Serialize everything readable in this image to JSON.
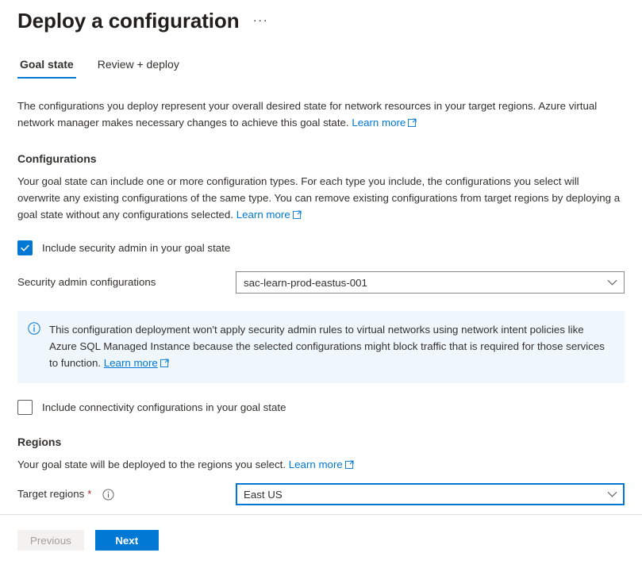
{
  "header": {
    "title": "Deploy a configuration",
    "more_menu": "···"
  },
  "tabs": [
    {
      "label": "Goal state",
      "active": true
    },
    {
      "label": "Review + deploy",
      "active": false
    }
  ],
  "intro": {
    "text": "The configurations you deploy represent your overall desired state for network resources in your target regions. Azure virtual network manager makes necessary changes to achieve this goal state.",
    "link": "Learn more"
  },
  "configurations": {
    "heading": "Configurations",
    "text": "Your goal state can include one or more configuration types. For each type you include, the configurations you select will overwrite any existing configurations of the same type. You can remove existing configurations from target regions by deploying a goal state without any configurations selected.",
    "link": "Learn more",
    "security_admin_checkbox": {
      "label": "Include security admin in your goal state",
      "checked": true
    },
    "security_admin_field": {
      "label": "Security admin configurations",
      "value": "sac-learn-prod-eastus-001"
    },
    "connectivity_checkbox": {
      "label": "Include connectivity configurations in your goal state",
      "checked": false
    }
  },
  "banner": {
    "icon": "info-icon",
    "text": "This configuration deployment won't apply security admin rules to virtual networks using network intent policies like Azure SQL Managed Instance because the selected configurations might block traffic that is required for those services to function.",
    "link": "Learn more"
  },
  "regions": {
    "heading": "Regions",
    "text": "Your goal state will be deployed to the regions you select.",
    "link": "Learn more",
    "target_field": {
      "label": "Target regions",
      "required_marker": "*",
      "value": "East US"
    }
  },
  "footer": {
    "previous_label": "Previous",
    "next_label": "Next"
  },
  "colors": {
    "accent": "#0078d4",
    "banner_bg": "#eff6fc",
    "required": "#a4262c",
    "disabled_bg": "#f3f2f1",
    "disabled_text": "#a19f9d",
    "border": "#8a8886"
  }
}
